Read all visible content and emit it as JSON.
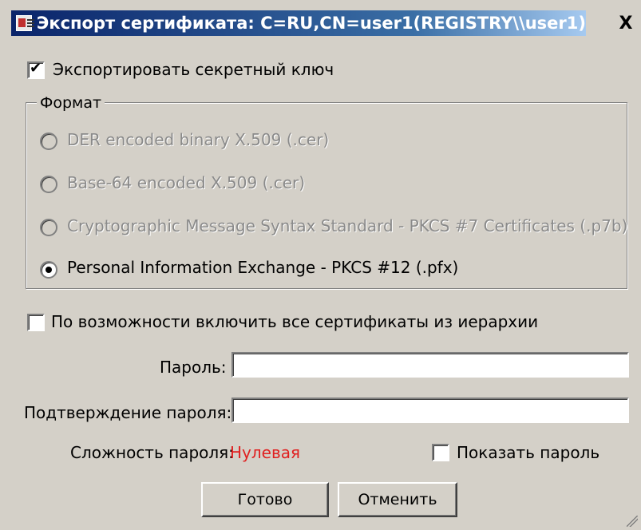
{
  "window": {
    "title": "Экспорт сертификата: C=RU,CN=user1(REGISTRY\\\\user1)",
    "close_label": "X"
  },
  "export_key": {
    "label": "Экспортировать секретный ключ",
    "checked": true,
    "check_mark": "✔"
  },
  "format": {
    "title": "Формат",
    "options": [
      {
        "label": "DER encoded binary X.509 (.cer)",
        "enabled": false,
        "selected": false
      },
      {
        "label": "Base-64 encoded X.509 (.cer)",
        "enabled": false,
        "selected": false
      },
      {
        "label": "Cryptographic Message Syntax Standard - PKCS #7 Certificates (.p7b)",
        "enabled": false,
        "selected": false
      },
      {
        "label": "Personal Information Exchange - PKCS #12 (.pfx)",
        "enabled": true,
        "selected": true
      }
    ]
  },
  "include_all": {
    "label": "По возможности включить все сертификаты из иерархии",
    "checked": false
  },
  "password": {
    "label": "Пароль:",
    "value": ""
  },
  "confirm": {
    "label": "Подтверждение пароля:",
    "value": ""
  },
  "strength": {
    "label": "Сложность пароля:",
    "value": "Нулевая",
    "color": "#e02020"
  },
  "show_password": {
    "label": "Показать пароль",
    "checked": false
  },
  "buttons": {
    "ok": "Готово",
    "cancel": "Отменить"
  }
}
